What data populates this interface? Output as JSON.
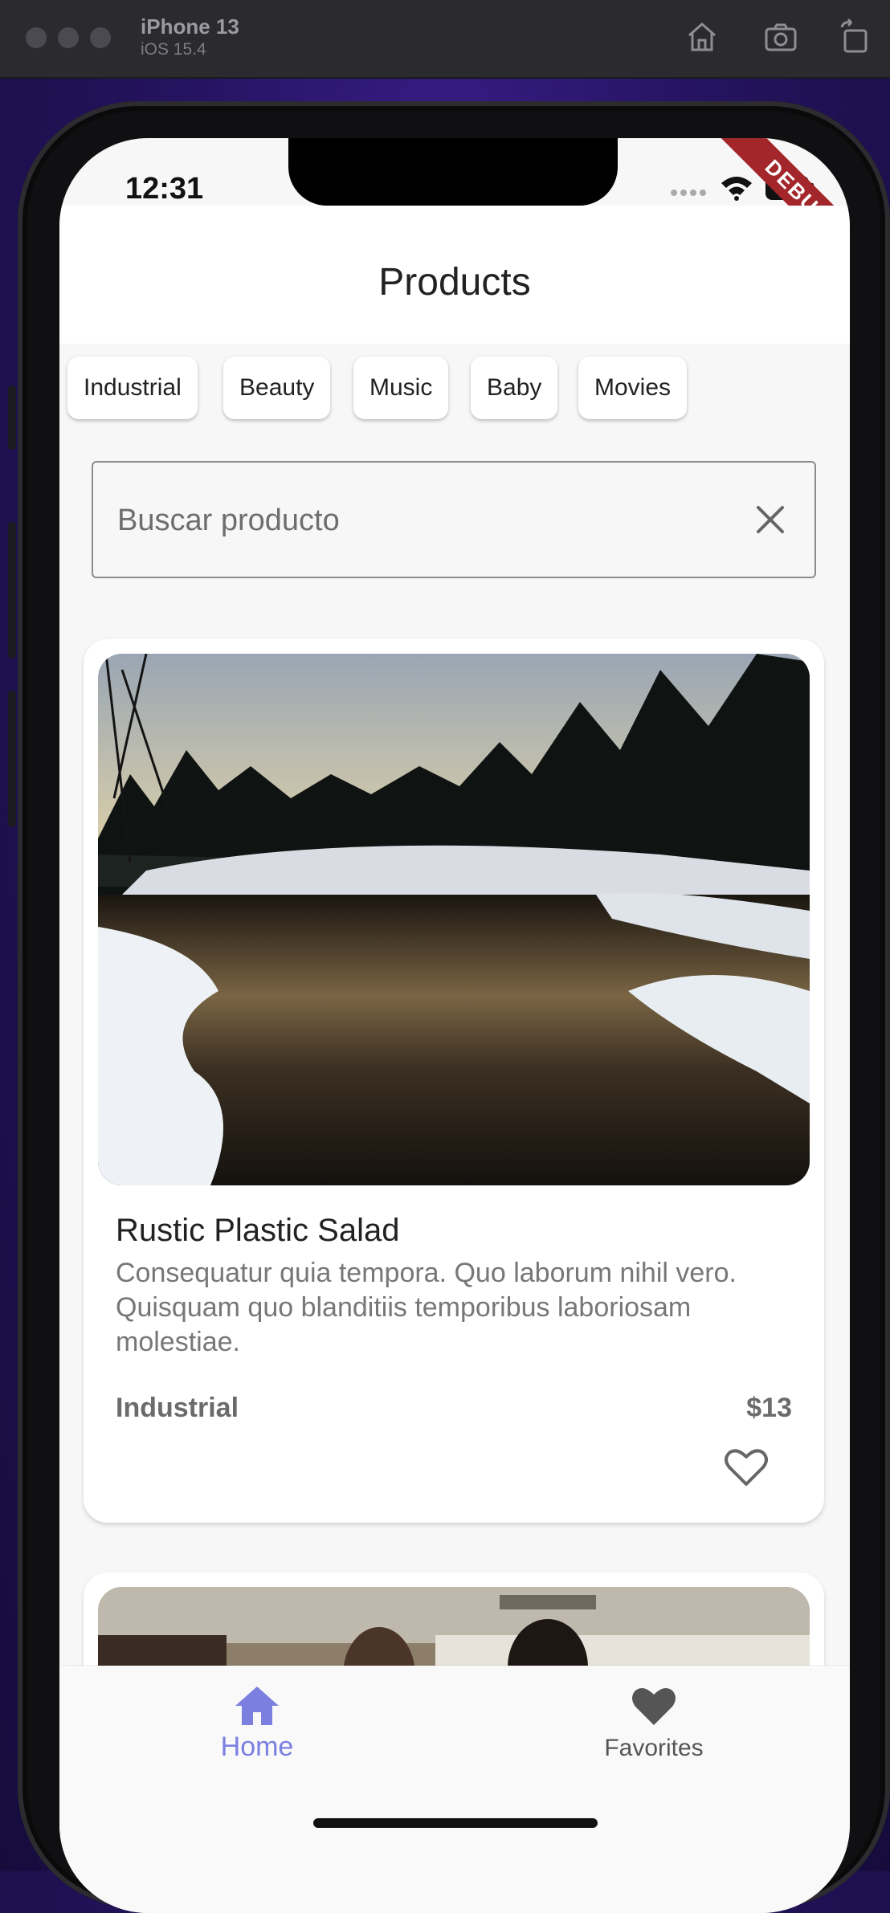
{
  "simulator": {
    "device_name": "iPhone 13",
    "os_version": "iOS 15.4",
    "icons": [
      "home-icon",
      "screenshot-icon",
      "rotate-icon"
    ]
  },
  "status_bar": {
    "time": "12:31",
    "debug_banner": "DEBUG",
    "icons": [
      "signal-icon",
      "wifi-icon",
      "battery-icon"
    ]
  },
  "app_bar": {
    "title": "Products"
  },
  "categories": [
    "Industrial",
    "Beauty",
    "Music",
    "Baby",
    "Movies"
  ],
  "search": {
    "placeholder": "Buscar producto",
    "value": ""
  },
  "products": [
    {
      "image": "snowy-river-sunset-photo",
      "name": "Rustic Plastic Salad",
      "description": "Consequatur quia tempora. Quo laborum nihil vero. Quisquam quo blanditiis temporibus laboriosam molestiae.",
      "category": "Industrial",
      "price": "$13",
      "favorite": false
    },
    {
      "image": "people-indoor-photo"
    }
  ],
  "bottom_nav": {
    "items": [
      {
        "label": "Home",
        "icon": "home-icon",
        "active": true
      },
      {
        "label": "Favorites",
        "icon": "heart-icon",
        "active": false
      }
    ]
  },
  "colors": {
    "accent": "#7b80e0",
    "inactive_nav": "#555555",
    "background": "#f7f7f7",
    "debug_banner": "#a3262b"
  }
}
